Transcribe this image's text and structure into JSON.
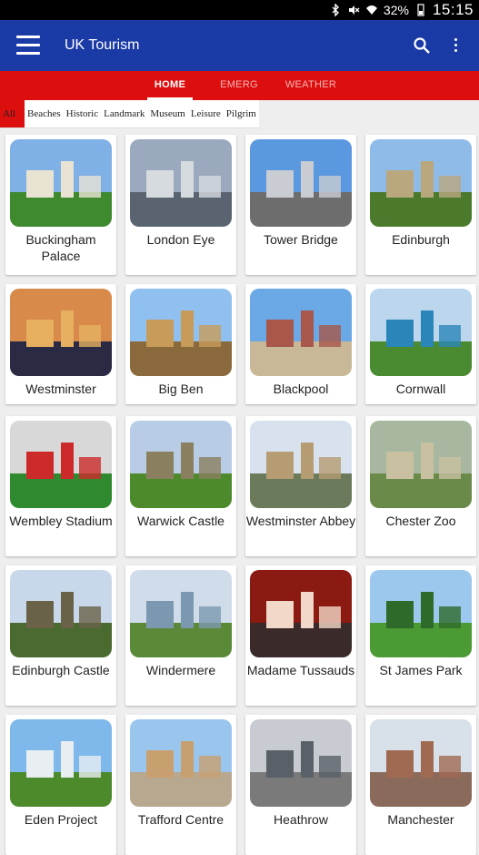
{
  "status": {
    "battery": "32%",
    "time": "15:15"
  },
  "appbar": {
    "title": "UK Tourism"
  },
  "tabs": [
    {
      "label": "HOME",
      "active": true
    },
    {
      "label": "EMERG",
      "active": false
    },
    {
      "label": "WEATHER",
      "active": false
    }
  ],
  "filters": [
    {
      "label": "All",
      "active": true
    },
    {
      "label": "Beaches"
    },
    {
      "label": "Historic"
    },
    {
      "label": "Landmark"
    },
    {
      "label": "Museum"
    },
    {
      "label": "Leisure"
    },
    {
      "label": "Pilgrim"
    }
  ],
  "places": [
    {
      "name": "Buckingham Palace",
      "sky": "#7fb0e6",
      "ground": "#3f8a2e",
      "accent": "#e9e3d4"
    },
    {
      "name": "London Eye",
      "sky": "#9aa9bd",
      "ground": "#5a6470",
      "accent": "#d6dbe0"
    },
    {
      "name": "Tower Bridge",
      "sky": "#5a98e0",
      "ground": "#6d6d6d",
      "accent": "#c9ccd2"
    },
    {
      "name": "Edinburgh",
      "sky": "#8fbbe8",
      "ground": "#4c7a2c",
      "accent": "#b9a77e"
    },
    {
      "name": "Westminster",
      "sky": "#d88a4a",
      "ground": "#2a2a44",
      "accent": "#e6b060"
    },
    {
      "name": "Big Ben",
      "sky": "#8fc0ef",
      "ground": "#8a6a3c",
      "accent": "#c79b5a"
    },
    {
      "name": "Blackpool",
      "sky": "#6aa8e6",
      "ground": "#c8b898",
      "accent": "#a8574a"
    },
    {
      "name": "Cornwall",
      "sky": "#bcd6ee",
      "ground": "#4a8a30",
      "accent": "#2a86b8"
    },
    {
      "name": "Wembley Stadium",
      "sky": "#d8d8d8",
      "ground": "#2f8a2f",
      "accent": "#cc2a2a"
    },
    {
      "name": "Warwick Castle",
      "sky": "#b8cce6",
      "ground": "#4c8a2c",
      "accent": "#8a8060"
    },
    {
      "name": "Westminster Abbey",
      "sky": "#d8e2ee",
      "ground": "#6a7a5a",
      "accent": "#b59c72"
    },
    {
      "name": "Chester Zoo",
      "sky": "#a8b8a0",
      "ground": "#6a8a4a",
      "accent": "#c8c0a0"
    },
    {
      "name": "Edinburgh Castle",
      "sky": "#c8d8ea",
      "ground": "#4a6a30",
      "accent": "#6a6248"
    },
    {
      "name": "Windermere",
      "sky": "#d0dcea",
      "ground": "#5a8a38",
      "accent": "#7a98b0"
    },
    {
      "name": "Madame Tussauds",
      "sky": "#8a1a12",
      "ground": "#3a2a2a",
      "accent": "#f2d8c8"
    },
    {
      "name": "St James Park",
      "sky": "#9cc8ee",
      "ground": "#4c9a34",
      "accent": "#2e6a2a"
    },
    {
      "name": "Eden Project",
      "sky": "#7fb8ea",
      "ground": "#4c8a2c",
      "accent": "#e8eef2"
    },
    {
      "name": "Trafford Centre",
      "sky": "#9ac6ee",
      "ground": "#b8a890",
      "accent": "#c8a070"
    },
    {
      "name": "Heathrow",
      "sky": "#c8ccd2",
      "ground": "#7a7a7a",
      "accent": "#5a6068"
    },
    {
      "name": "Manchester",
      "sky": "#d8e0ea",
      "ground": "#8a6a5a",
      "accent": "#a06a52"
    }
  ]
}
